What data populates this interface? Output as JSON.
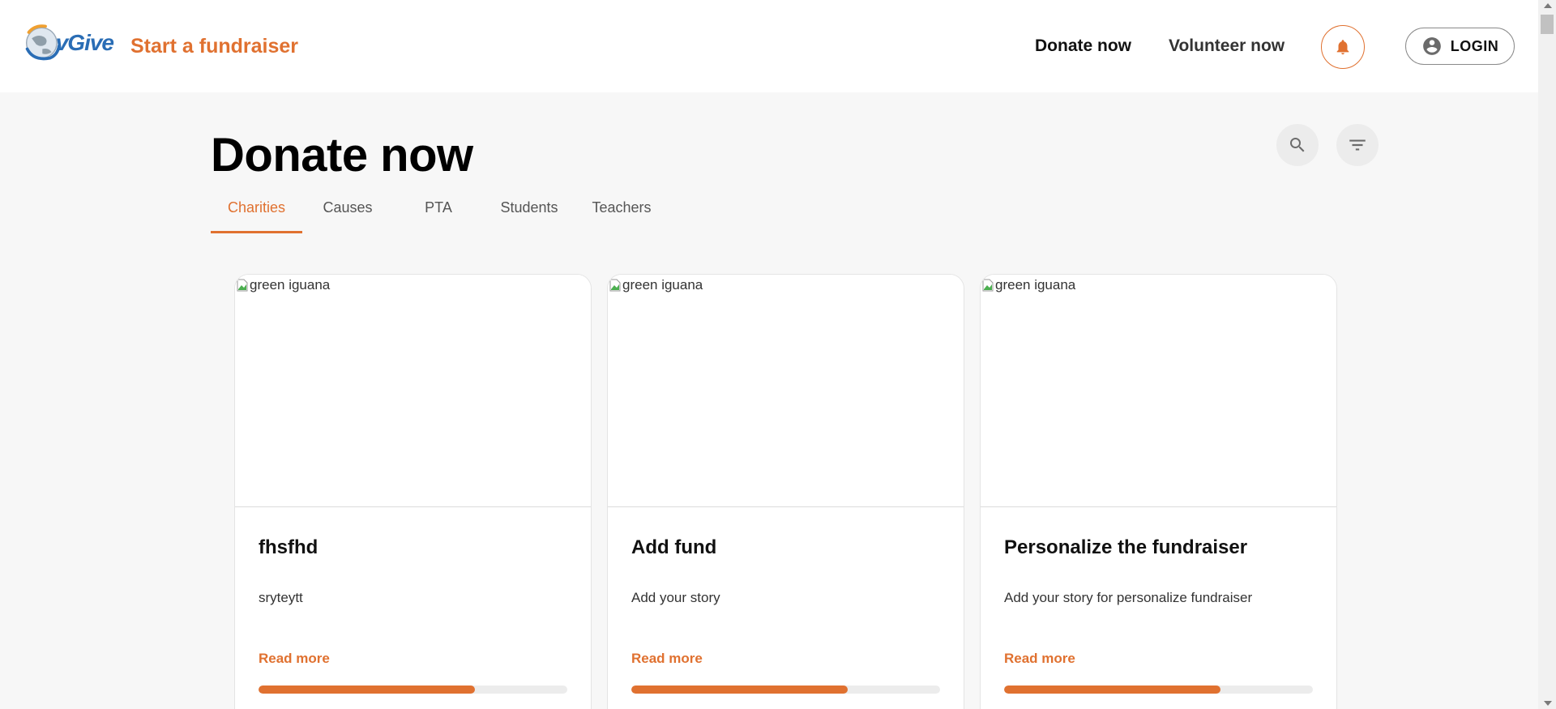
{
  "header": {
    "logo_text": "vGive",
    "start_fundraiser": "Start a fundraiser",
    "nav": {
      "donate": "Donate now",
      "volunteer": "Volunteer now"
    },
    "login_label": "LOGIN"
  },
  "main": {
    "title": "Donate now",
    "tabs": [
      {
        "label": "Charities",
        "active": true
      },
      {
        "label": "Causes",
        "active": false
      },
      {
        "label": "PTA",
        "active": false
      },
      {
        "label": "Students",
        "active": false
      },
      {
        "label": "Teachers",
        "active": false
      }
    ],
    "cards": [
      {
        "image_alt": "green iguana",
        "title": "fhsfhd",
        "description": "sryteytt",
        "read_more": "Read more",
        "progress": 0.7
      },
      {
        "image_alt": "green iguana",
        "title": "Add fund",
        "description": "Add your story",
        "read_more": "Read more",
        "progress": 0.7
      },
      {
        "image_alt": "green iguana",
        "title": "Personalize the fundraiser",
        "description": "Add your story for personalize fundraiser",
        "read_more": "Read more",
        "progress": 0.7
      }
    ]
  },
  "colors": {
    "accent": "#e07130",
    "background": "#f7f7f7",
    "logo_blue": "#2a6db5"
  },
  "icons": {
    "bell": "bell-icon",
    "user": "account-circle-icon",
    "search": "search-icon",
    "filter": "filter-icon"
  }
}
